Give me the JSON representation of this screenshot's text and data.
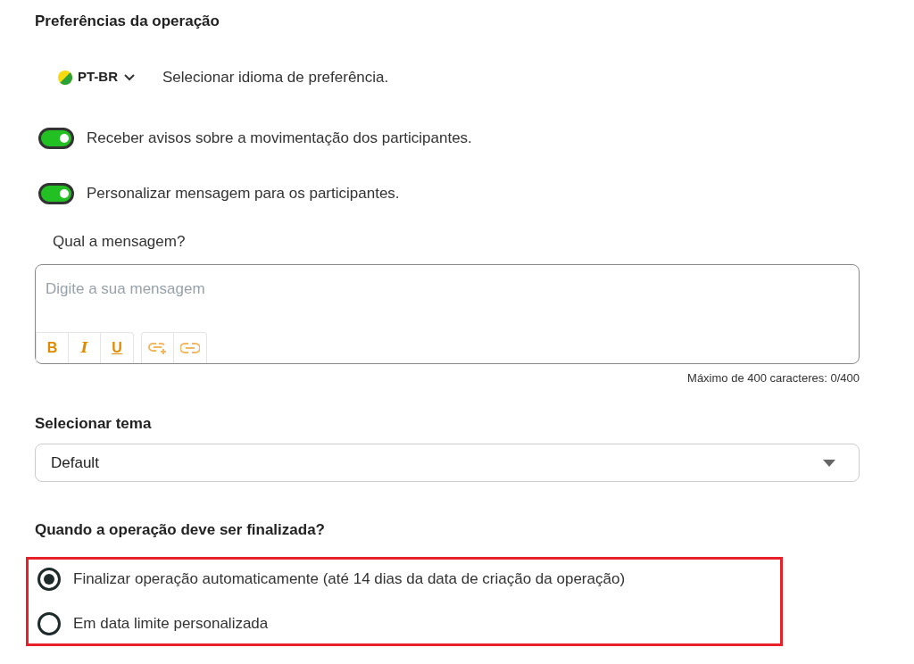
{
  "title": "Preferências da operação",
  "language": {
    "code": "PT-BR",
    "label": "Selecionar idioma de preferência."
  },
  "toggles": [
    {
      "label": "Receber avisos sobre a movimentação dos participantes.",
      "on": true
    },
    {
      "label": "Personalizar mensagem para os participantes.",
      "on": true
    }
  ],
  "message": {
    "label": "Qual a mensagem?",
    "placeholder": "Digite a sua mensagem",
    "format_buttons": [
      "B",
      "I",
      "U"
    ],
    "counter": "Máximo de 400 caracteres: 0/400"
  },
  "theme": {
    "label": "Selecionar tema",
    "value": "Default"
  },
  "finish": {
    "question": "Quando a operação deve ser finalizada?",
    "highlighted": true,
    "options": [
      {
        "label": "Finalizar operação automaticamente (até 14 dias da data de criação da operação)",
        "selected": true
      },
      {
        "label": "Em data limite personalizada",
        "selected": false
      }
    ]
  }
}
